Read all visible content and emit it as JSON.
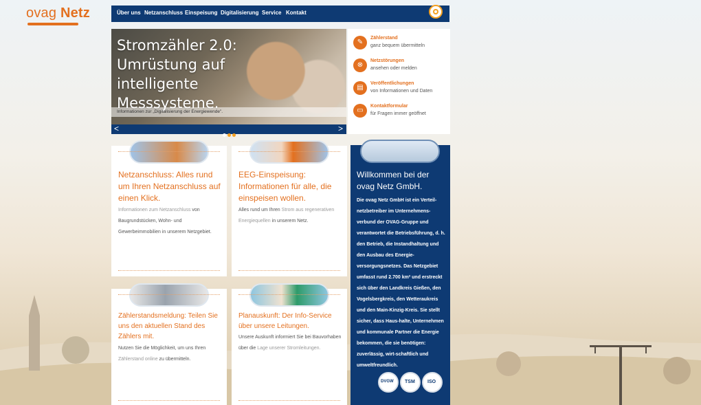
{
  "logo": {
    "part1": "ovag",
    "part2": "Netz"
  },
  "nav": {
    "items": [
      "Über uns",
      "Netzanschluss",
      "Einspeisung",
      "Digitalisierung",
      "Service",
      "Kontakt"
    ]
  },
  "hero": {
    "title_lines": [
      "Stromzähler 2.0:",
      "Umrüstung auf intelligente",
      "Messsysteme."
    ],
    "caption": "Informationen zur „Digitalisierung der Energiewende\".",
    "prev": "<",
    "next": ">"
  },
  "quick_links": [
    {
      "title": "Zählerstand",
      "sub": "ganz bequem übermitteln",
      "icon": "pencil-icon"
    },
    {
      "title": "Netzstörungen",
      "sub": "ansehen oder melden",
      "icon": "cross-circle-icon"
    },
    {
      "title": "Veröffentlichungen",
      "sub": "von Informationen und Daten",
      "icon": "document-icon"
    },
    {
      "title": "Kontaktformular",
      "sub": "für Fragen immer geöffnet",
      "icon": "laptop-icon"
    }
  ],
  "cards": {
    "netzanschluss": {
      "title": "Netzanschluss: Alles rund um Ihren Netzanschluss auf einen Klick.",
      "link": "Informationen zum Netzanschluss",
      "text": "von Baugrundstücken, Wohn- und Gewerbeimmobilien in unserem Netzgebiet."
    },
    "eeg": {
      "title": "EEG-Einspeisung: Informationen für alle, die einspeisen wollen.",
      "text1": "Alles rund um Ihren",
      "link": "Strom aus regenerativen Energiequellen",
      "text2": "in unserem Netz."
    },
    "zaehler": {
      "title": "Zählerstandsmeldung: Teilen Sie uns den aktuellen Stand des Zählers mit.",
      "text1": "Nutzen Sie die Möglichkeit, um uns Ihren",
      "link": "Zählerstand online",
      "text2": "zu übermitteln."
    },
    "planauskunft": {
      "title": "Planauskunft: Der Info-Service über unsere Leitungen.",
      "text1": "Unsere Auskunft informiert Sie bei Bauvorhaben über die",
      "link": "Lage unserer Stromleitungen."
    }
  },
  "welcome": {
    "title": "Willkommen bei der ovag Netz GmbH.",
    "text": "Die ovag Netz GmbH ist ein Verteil-netzbetreiber im Unternehmens-verbund der OVAG-Gruppe und verantwortet die Betriebsführung, d. h. den Betrieb, die Instandhaltung und den Ausbau des Energie-versorgungsnetzes. Das Netzgebiet umfasst rund 2.700 km² und erstreckt sich über den Landkreis Gießen, den Vogelsbergkreis, den Wetteraukreis und den Main-Kinzig-Kreis. Sie stellt sicher, dass Haus-halte, Unternehmen und kommunale Partner die Energie bekommen, die sie benötigen: zuverlässig, wirt-schaftlich und umweltfreundlich.",
    "badges": [
      "DVGW",
      "TSM",
      "ISO"
    ]
  },
  "colors": {
    "navy": "#0e3a73",
    "orange": "#e3701f"
  }
}
